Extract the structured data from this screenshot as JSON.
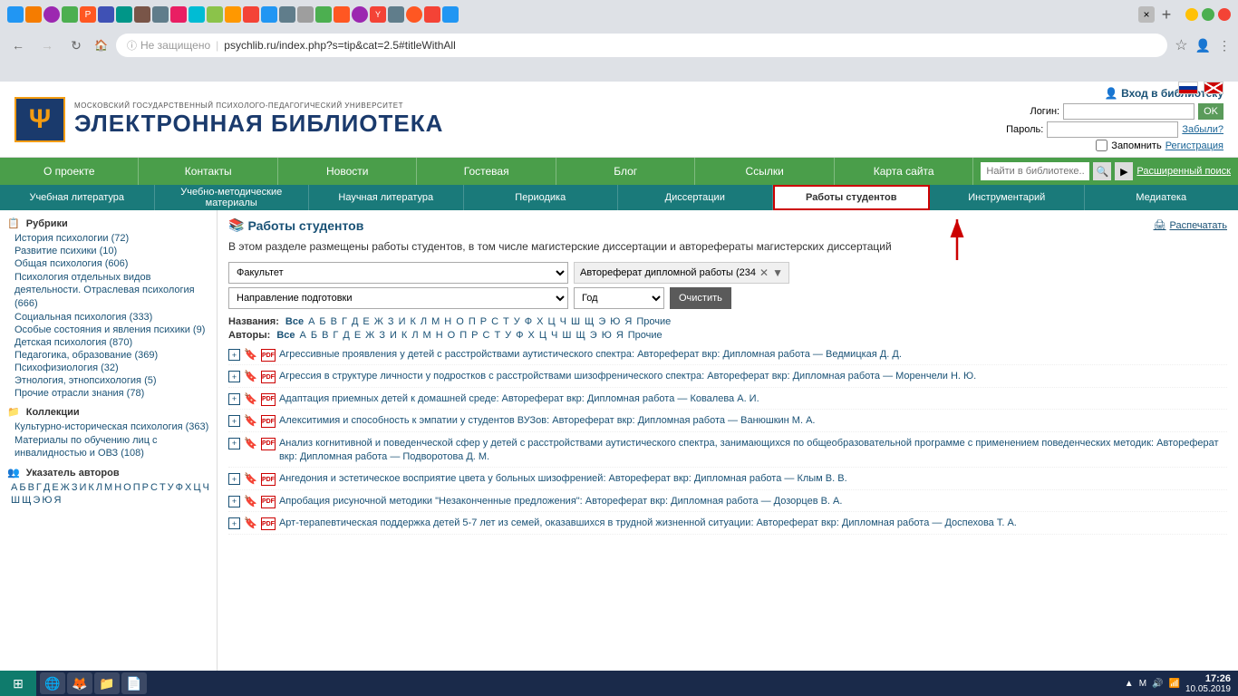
{
  "browser": {
    "tab_title": "psychlib.ru/index.php?s=tip&cat=2.5#titleWithAll",
    "url": "psychlib.ru/index.php?s=tip&cat=2.5#titleWithAll",
    "insecure_label": "Не защищено",
    "new_tab_label": "+"
  },
  "header": {
    "logo_letter": "Ψ",
    "subtitle": "МОСКОВСКИЙ ГОСУДАРСТВЕННЫЙ ПСИХОЛОГО-ПЕДАГОГИЧЕСКИЙ УНИВЕРСИТЕТ",
    "title": "ЭЛЕКТРОННАЯ БИБЛИОТЕКА",
    "login_section_label": "Вход в библиотеку",
    "login_label": "Логин:",
    "password_label": "Пароль:",
    "ok_label": "OK",
    "forgot_label": "Забыли?",
    "remember_label": "Запомнить",
    "register_label": "Регистрация"
  },
  "main_nav": {
    "items": [
      {
        "label": "О проекте"
      },
      {
        "label": "Контакты"
      },
      {
        "label": "Новости"
      },
      {
        "label": "Гостевая"
      },
      {
        "label": "Блог"
      },
      {
        "label": "Ссылки"
      },
      {
        "label": "Карта сайта"
      }
    ],
    "search_placeholder": "Найти в библиотеке...",
    "advanced_search_label": "Расширенный поиск"
  },
  "sub_nav": {
    "items": [
      {
        "label": "Учебная литература",
        "active": false
      },
      {
        "label": "Учебно-методические материалы",
        "active": false
      },
      {
        "label": "Научная литература",
        "active": false
      },
      {
        "label": "Периодика",
        "active": false
      },
      {
        "label": "Диссертации",
        "active": false
      },
      {
        "label": "Работы студентов",
        "active": true
      },
      {
        "label": "Инструментарий",
        "active": false
      },
      {
        "label": "Медиатека",
        "active": false
      }
    ]
  },
  "sidebar": {
    "sections": [
      {
        "title": "Рубрики",
        "links": [
          {
            "label": "История психологии (72)"
          },
          {
            "label": "Развитие психики (10)"
          },
          {
            "label": "Общая психология (606)"
          },
          {
            "label": "Психология отдельных видов деятельности. Отраслевая психология (666)"
          },
          {
            "label": "Социальная психология (333)"
          },
          {
            "label": "Особые состояния и явления психики (9)"
          },
          {
            "label": "Детская психология (870)"
          },
          {
            "label": "Педагогика, образование (369)"
          },
          {
            "label": "Психофизиология (32)"
          },
          {
            "label": "Этнология, этнопсихология (5)"
          },
          {
            "label": "Прочие отрасли знания (78)"
          }
        ]
      },
      {
        "title": "Коллекции",
        "links": [
          {
            "label": "Культурно-историческая психология (363)"
          },
          {
            "label": "Материалы по обучению лиц с инвалидностью и ОВЗ (108)"
          }
        ]
      },
      {
        "title": "Указатель авторов",
        "alpha": "А Б В Г Д Е Ж З И К Л М Н О П Р С Т У Ф Х Ц Ч Ш Щ Э Ю Я"
      }
    ]
  },
  "content": {
    "section_title": "Работы студентов",
    "print_label": "Распечатать",
    "description": "В этом разделе размещены работы студентов, в том числе магистерские диссертации и авторефераты магистерских диссертаций",
    "faculty_placeholder": "Факультет",
    "direction_placeholder": "Направление подготовки",
    "year_placeholder": "Год",
    "filter_tag": "Автореферат дипломной работы (234",
    "clear_label": "Очистить",
    "titles_label": "Названия:",
    "authors_label": "Авторы:",
    "alpha_letters": [
      "Все",
      "А",
      "Б",
      "В",
      "Г",
      "Д",
      "Е",
      "Ж",
      "З",
      "И",
      "К",
      "Л",
      "М",
      "Н",
      "О",
      "П",
      "Р",
      "С",
      "Т",
      "У",
      "Ф",
      "Х",
      "Ц",
      "Ч",
      "Ш",
      "Щ",
      "Э",
      "Ю",
      "Я",
      "Прочие"
    ],
    "books": [
      {
        "title": "Агрессивные проявления у детей с расстройствами аутистического спектра: Автореферат вкр: Дипломная работа — Ведмицкая Д. Д."
      },
      {
        "title": "Агрессия в структуре личности у подростков с расстройствами шизофренического спектра: Автореферат вкр: Дипломная работа — Моренчели Н. Ю."
      },
      {
        "title": "Адаптация приемных детей к домашней среде: Автореферат вкр: Дипломная работа — Ковалева А. И."
      },
      {
        "title": "Алекситимия и способность к эмпатии у студентов ВУЗов: Автореферат вкр: Дипломная работа — Ванюшкин М. А."
      },
      {
        "title": "Анализ когнитивной и поведенческой сфер у детей с расстройствами аутистического спектра, занимающихся по общеобразовательной программе с применением поведенческих методик: Автореферат вкр: Дипломная работа — Подворотова Д. М."
      },
      {
        "title": "Ангедония и эстетическое восприятие цвета у больных шизофренией: Автореферат вкр: Дипломная работа — Клым В. В."
      },
      {
        "title": "Апробация рисуночной методики \"Незаконченные предложения\": Автореферат вкр: Дипломная работа — Дозорцев В. А."
      },
      {
        "title": "Арт-терапевтическая поддержка детей 5-7 лет из семей, оказавшихся в трудной жизненной ситуации: Автореферат вкр: Дипломная работа — Доспехова Т. А."
      }
    ]
  },
  "taskbar": {
    "time": "17:26",
    "date": "10.05.2019"
  }
}
